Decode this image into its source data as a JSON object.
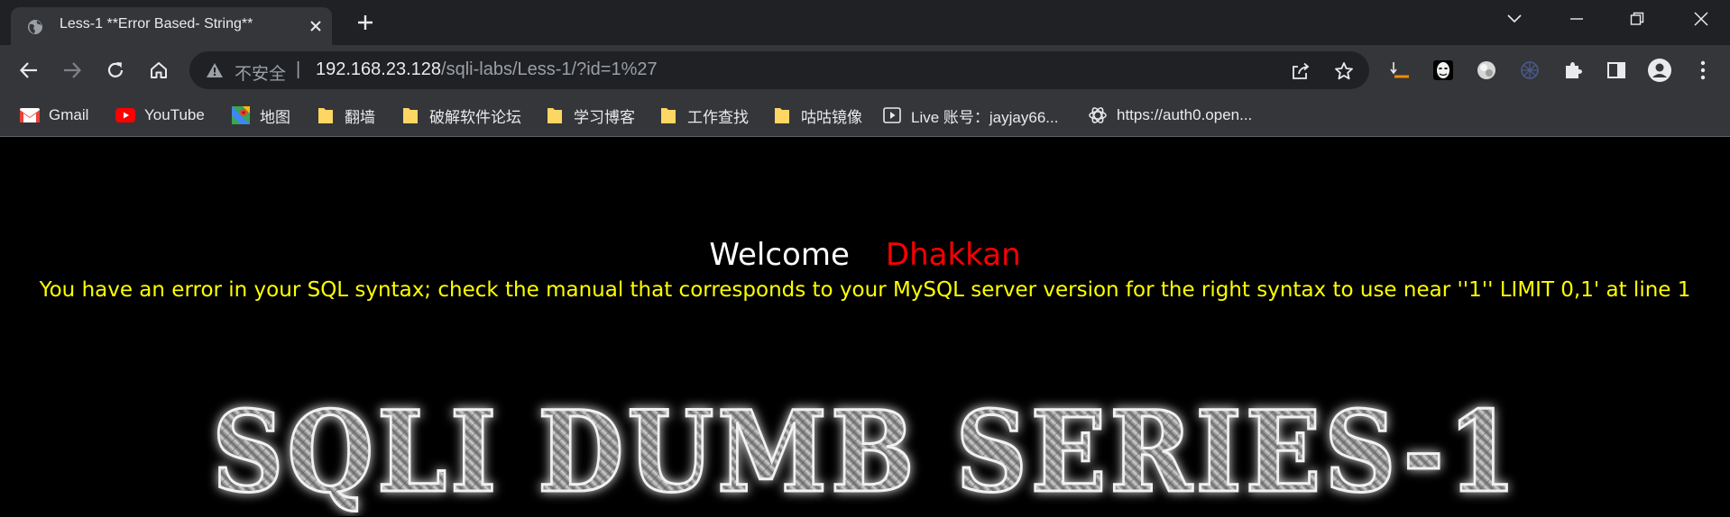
{
  "browser": {
    "tab": {
      "title": "Less-1 **Error Based- String**"
    },
    "address": {
      "security_label": "不安全",
      "separator": "|",
      "host": "192.168.23.128",
      "path": "/sqli-labs/Less-1/?id=1%27"
    },
    "bookmarks": [
      {
        "label": "Gmail",
        "icon": "gmail-icon"
      },
      {
        "label": "YouTube",
        "icon": "youtube-icon"
      },
      {
        "label": "地图",
        "icon": "maps-icon"
      },
      {
        "label": "翻墙",
        "icon": "folder-icon"
      },
      {
        "label": "破解软件论坛",
        "icon": "folder-icon"
      },
      {
        "label": "学习博客",
        "icon": "folder-icon"
      },
      {
        "label": "工作查找",
        "icon": "folder-icon"
      },
      {
        "label": "咕咕镜像",
        "icon": "folder-icon"
      },
      {
        "label": "Live 账号：jayjay66...",
        "icon": "play-icon"
      },
      {
        "label": "https://auth0.open...",
        "icon": "openai-icon"
      }
    ],
    "toolbar_icons": [
      "back-icon",
      "forward-icon",
      "reload-icon",
      "home-icon",
      "share-icon",
      "star-icon",
      "extension-icon",
      "sidepanel-icon",
      "profile-icon",
      "menu-icon"
    ],
    "colors": {
      "frame": "#202124",
      "toolbar": "#35363a",
      "text": "#e8eaed",
      "muted": "#9aa0a6"
    }
  },
  "page": {
    "welcome": "Welcome",
    "name": "Dhakkan",
    "error": "You have an error in your SQL syntax; check the manual that corresponds to your MySQL server version for the right syntax to use near ''1'' LIMIT 0,1' at line 1",
    "banner": "SQLI DUMB SERIES-1",
    "colors": {
      "welcome": "#ffffff",
      "name": "#ff0000",
      "error": "#ffff00",
      "background": "#000000"
    }
  }
}
